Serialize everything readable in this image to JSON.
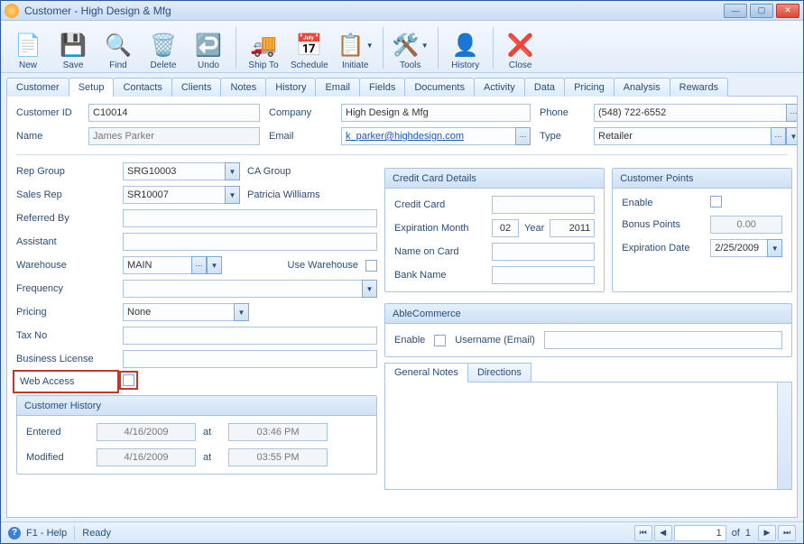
{
  "window": {
    "title": "Customer - High Design & Mfg"
  },
  "toolbar": {
    "new": "New",
    "save": "Save",
    "find": "Find",
    "delete": "Delete",
    "undo": "Undo",
    "shipto": "Ship To",
    "schedule": "Schedule",
    "initiate": "Initiate",
    "tools": "Tools",
    "history": "History",
    "close": "Close"
  },
  "tabs": [
    "Customer",
    "Setup",
    "Contacts",
    "Clients",
    "Notes",
    "History",
    "Email",
    "Fields",
    "Documents",
    "Activity",
    "Data",
    "Pricing",
    "Analysis",
    "Rewards"
  ],
  "active_tab": "Setup",
  "header": {
    "customer_id_lbl": "Customer ID",
    "customer_id": "C10014",
    "name_lbl": "Name",
    "name": "James Parker",
    "company_lbl": "Company",
    "company": "High Design & Mfg",
    "email_lbl": "Email",
    "email": "k_parker@highdesign.com",
    "phone_lbl": "Phone",
    "phone": "(548) 722-6552",
    "type_lbl": "Type",
    "type": "Retailer"
  },
  "left": {
    "rep_group_lbl": "Rep Group",
    "rep_group": "SRG10003",
    "rep_group_name": "CA Group",
    "sales_rep_lbl": "Sales Rep",
    "sales_rep": "SR10007",
    "sales_rep_name": "Patricia Williams",
    "referred_by_lbl": "Referred By",
    "referred_by": "",
    "assistant_lbl": "Assistant",
    "assistant": "",
    "warehouse_lbl": "Warehouse",
    "warehouse": "MAIN",
    "use_warehouse_lbl": "Use Warehouse",
    "frequency_lbl": "Frequency",
    "frequency": "",
    "pricing_lbl": "Pricing",
    "pricing": "None",
    "tax_no_lbl": "Tax No",
    "tax_no": "",
    "business_license_lbl": "Business License",
    "business_license": "",
    "web_access_lbl": "Web Access"
  },
  "customer_history": {
    "legend": "Customer History",
    "entered_lbl": "Entered",
    "entered_date": "4/16/2009",
    "at_lbl": "at",
    "entered_time": "03:46 PM",
    "modified_lbl": "Modified",
    "modified_date": "4/16/2009",
    "modified_time": "03:55 PM"
  },
  "cc": {
    "legend": "Credit Card Details",
    "credit_card_lbl": "Credit Card",
    "credit_card": "",
    "exp_month_lbl": "Expiration Month",
    "exp_month": "02",
    "year_lbl": "Year",
    "year": "2011",
    "name_on_card_lbl": "Name on Card",
    "name_on_card": "",
    "bank_name_lbl": "Bank Name",
    "bank_name": ""
  },
  "points": {
    "legend": "Customer Points",
    "enable_lbl": "Enable",
    "bonus_lbl": "Bonus Points",
    "bonus": "0.00",
    "exp_lbl": "Expiration Date",
    "exp": "2/25/2009"
  },
  "able": {
    "legend": "AbleCommerce",
    "enable_lbl": "Enable",
    "username_lbl": "Username (Email)",
    "username": ""
  },
  "notes": {
    "general_lbl": "General Notes",
    "directions_lbl": "Directions"
  },
  "status": {
    "help": "F1 - Help",
    "ready": "Ready",
    "page": "1",
    "of_lbl": "of",
    "total": "1"
  }
}
